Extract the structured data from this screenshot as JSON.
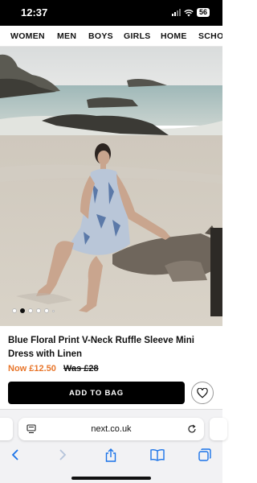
{
  "status_bar": {
    "time": "12:37",
    "battery": "56"
  },
  "nav": {
    "items": [
      "WOMEN",
      "MEN",
      "BOYS",
      "GIRLS",
      "HOME",
      "SCHO"
    ]
  },
  "gallery": {
    "image_count": 5,
    "active_index": 1
  },
  "product": {
    "title": "Blue Floral Print V-Neck Ruffle Sleeve Mini Dress with Linen",
    "price_now": "Now £12.50",
    "price_was": "Was £28"
  },
  "actions": {
    "add_to_bag": "ADD TO BAG"
  },
  "browser": {
    "url": "next.co.uk"
  },
  "icons": {
    "signal": "signal-icon",
    "wifi": "wifi-icon",
    "battery": "battery-icon",
    "wishlist": "heart-icon",
    "page_settings": "page-settings-icon",
    "reload": "reload-icon",
    "back": "back-chevron-icon",
    "forward": "forward-chevron-icon",
    "share": "share-icon",
    "bookmarks": "bookmarks-icon",
    "tabs": "tabs-icon"
  },
  "colors": {
    "price_now": "#e8762b",
    "button_bg": "#000000",
    "browser_accent": "#1a73e8"
  }
}
